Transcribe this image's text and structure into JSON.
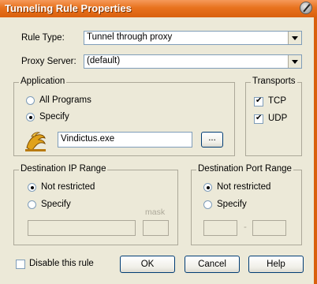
{
  "window": {
    "title": "Tunneling Rule Properties"
  },
  "rule_type": {
    "label": "Rule Type:",
    "value": "Tunnel through proxy"
  },
  "proxy_server": {
    "label": "Proxy Server:",
    "value": "(default)"
  },
  "application": {
    "title": "Application",
    "all_programs_label": "All Programs",
    "specify_label": "Specify",
    "program_path": "Vindictus.exe",
    "browse_label": "..."
  },
  "transports": {
    "title": "Transports",
    "tcp_label": "TCP",
    "udp_label": "UDP"
  },
  "destination_ip": {
    "title": "Destination IP Range",
    "not_restricted_label": "Not restricted",
    "specify_label": "Specify",
    "mask_label": "mask"
  },
  "destination_port": {
    "title": "Destination Port Range",
    "not_restricted_label": "Not restricted",
    "specify_label": "Specify",
    "range_separator": "-"
  },
  "footer": {
    "disable_label": "Disable this rule",
    "ok_label": "OK",
    "cancel_label": "Cancel",
    "help_label": "Help"
  }
}
